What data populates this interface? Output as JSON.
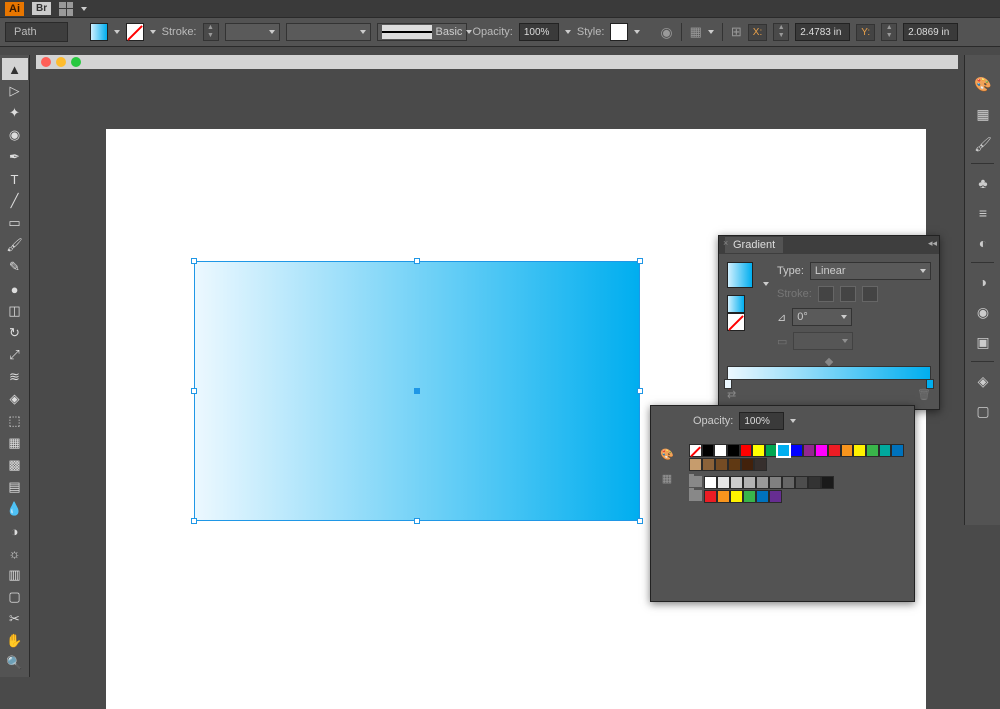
{
  "app": {
    "logo": "Ai",
    "bridge": "Br"
  },
  "control": {
    "selection": "Path",
    "stroke_label": "Stroke:",
    "brush_label": "Basic",
    "opacity_label": "Opacity:",
    "opacity_value": "100%",
    "style_label": "Style:",
    "x_label": "X:",
    "x_value": "2.4783 in",
    "y_label": "Y:",
    "y_value": "2.0869 in"
  },
  "traffic": {
    "close": "#ff5f57",
    "min": "#febc2e",
    "max": "#28c840"
  },
  "tools": [
    "selection",
    "direct-selection",
    "magic-wand",
    "lasso",
    "pen",
    "type",
    "line",
    "rectangle",
    "paintbrush",
    "pencil",
    "blob",
    "eraser",
    "rotate",
    "scale",
    "width",
    "free-transform",
    "shape-builder",
    "perspective",
    "mesh",
    "gradient",
    "eyedropper",
    "blend",
    "symbol",
    "graph",
    "artboard",
    "slice",
    "hand",
    "zoom"
  ],
  "right_icons": [
    "color",
    "swatches",
    "brushes",
    "symbols",
    "stroke",
    "gradient",
    "transparency",
    "appearance",
    "graphic-styles",
    "layers",
    "artboards-panel"
  ],
  "gradient": {
    "title": "Gradient",
    "type_label": "Type:",
    "type_value": "Linear",
    "stroke_label": "Stroke:",
    "angle_value": "0°",
    "stops": [
      {
        "pos": 0,
        "color": "#ecf8ff"
      },
      {
        "pos": 100,
        "color": "#00aeef"
      }
    ],
    "midpoint": 50
  },
  "swatches": {
    "opacity_label": "Opacity:",
    "opacity_value": "100%",
    "row1": [
      "#ffffff",
      "#000000",
      "#ff0000",
      "#ffff00",
      "#00a651",
      "#00aeef",
      "#0000ff",
      "#92278f",
      "#ff00ff",
      "#ed1c24",
      "#f7941d",
      "#fff200",
      "#39b54a",
      "#00a99d",
      "#0072bc",
      "#662d91",
      "#9e005d",
      "#790000",
      "#603913",
      "#8dc63e"
    ],
    "row2": [
      "#c69c6d",
      "#8b6239",
      "#754c24",
      "#603913",
      "#42210b",
      "#362f2d"
    ],
    "row3": [
      "#ffffff",
      "#e6e6e6",
      "#cccccc",
      "#b3b3b3",
      "#999999",
      "#808080",
      "#666666",
      "#4d4d4d",
      "#333333",
      "#1a1a1a"
    ],
    "row4": [
      "#ed1c24",
      "#f7941d",
      "#fff200",
      "#39b54a",
      "#0072bc",
      "#662d91"
    ],
    "selected": "#00aeef"
  }
}
